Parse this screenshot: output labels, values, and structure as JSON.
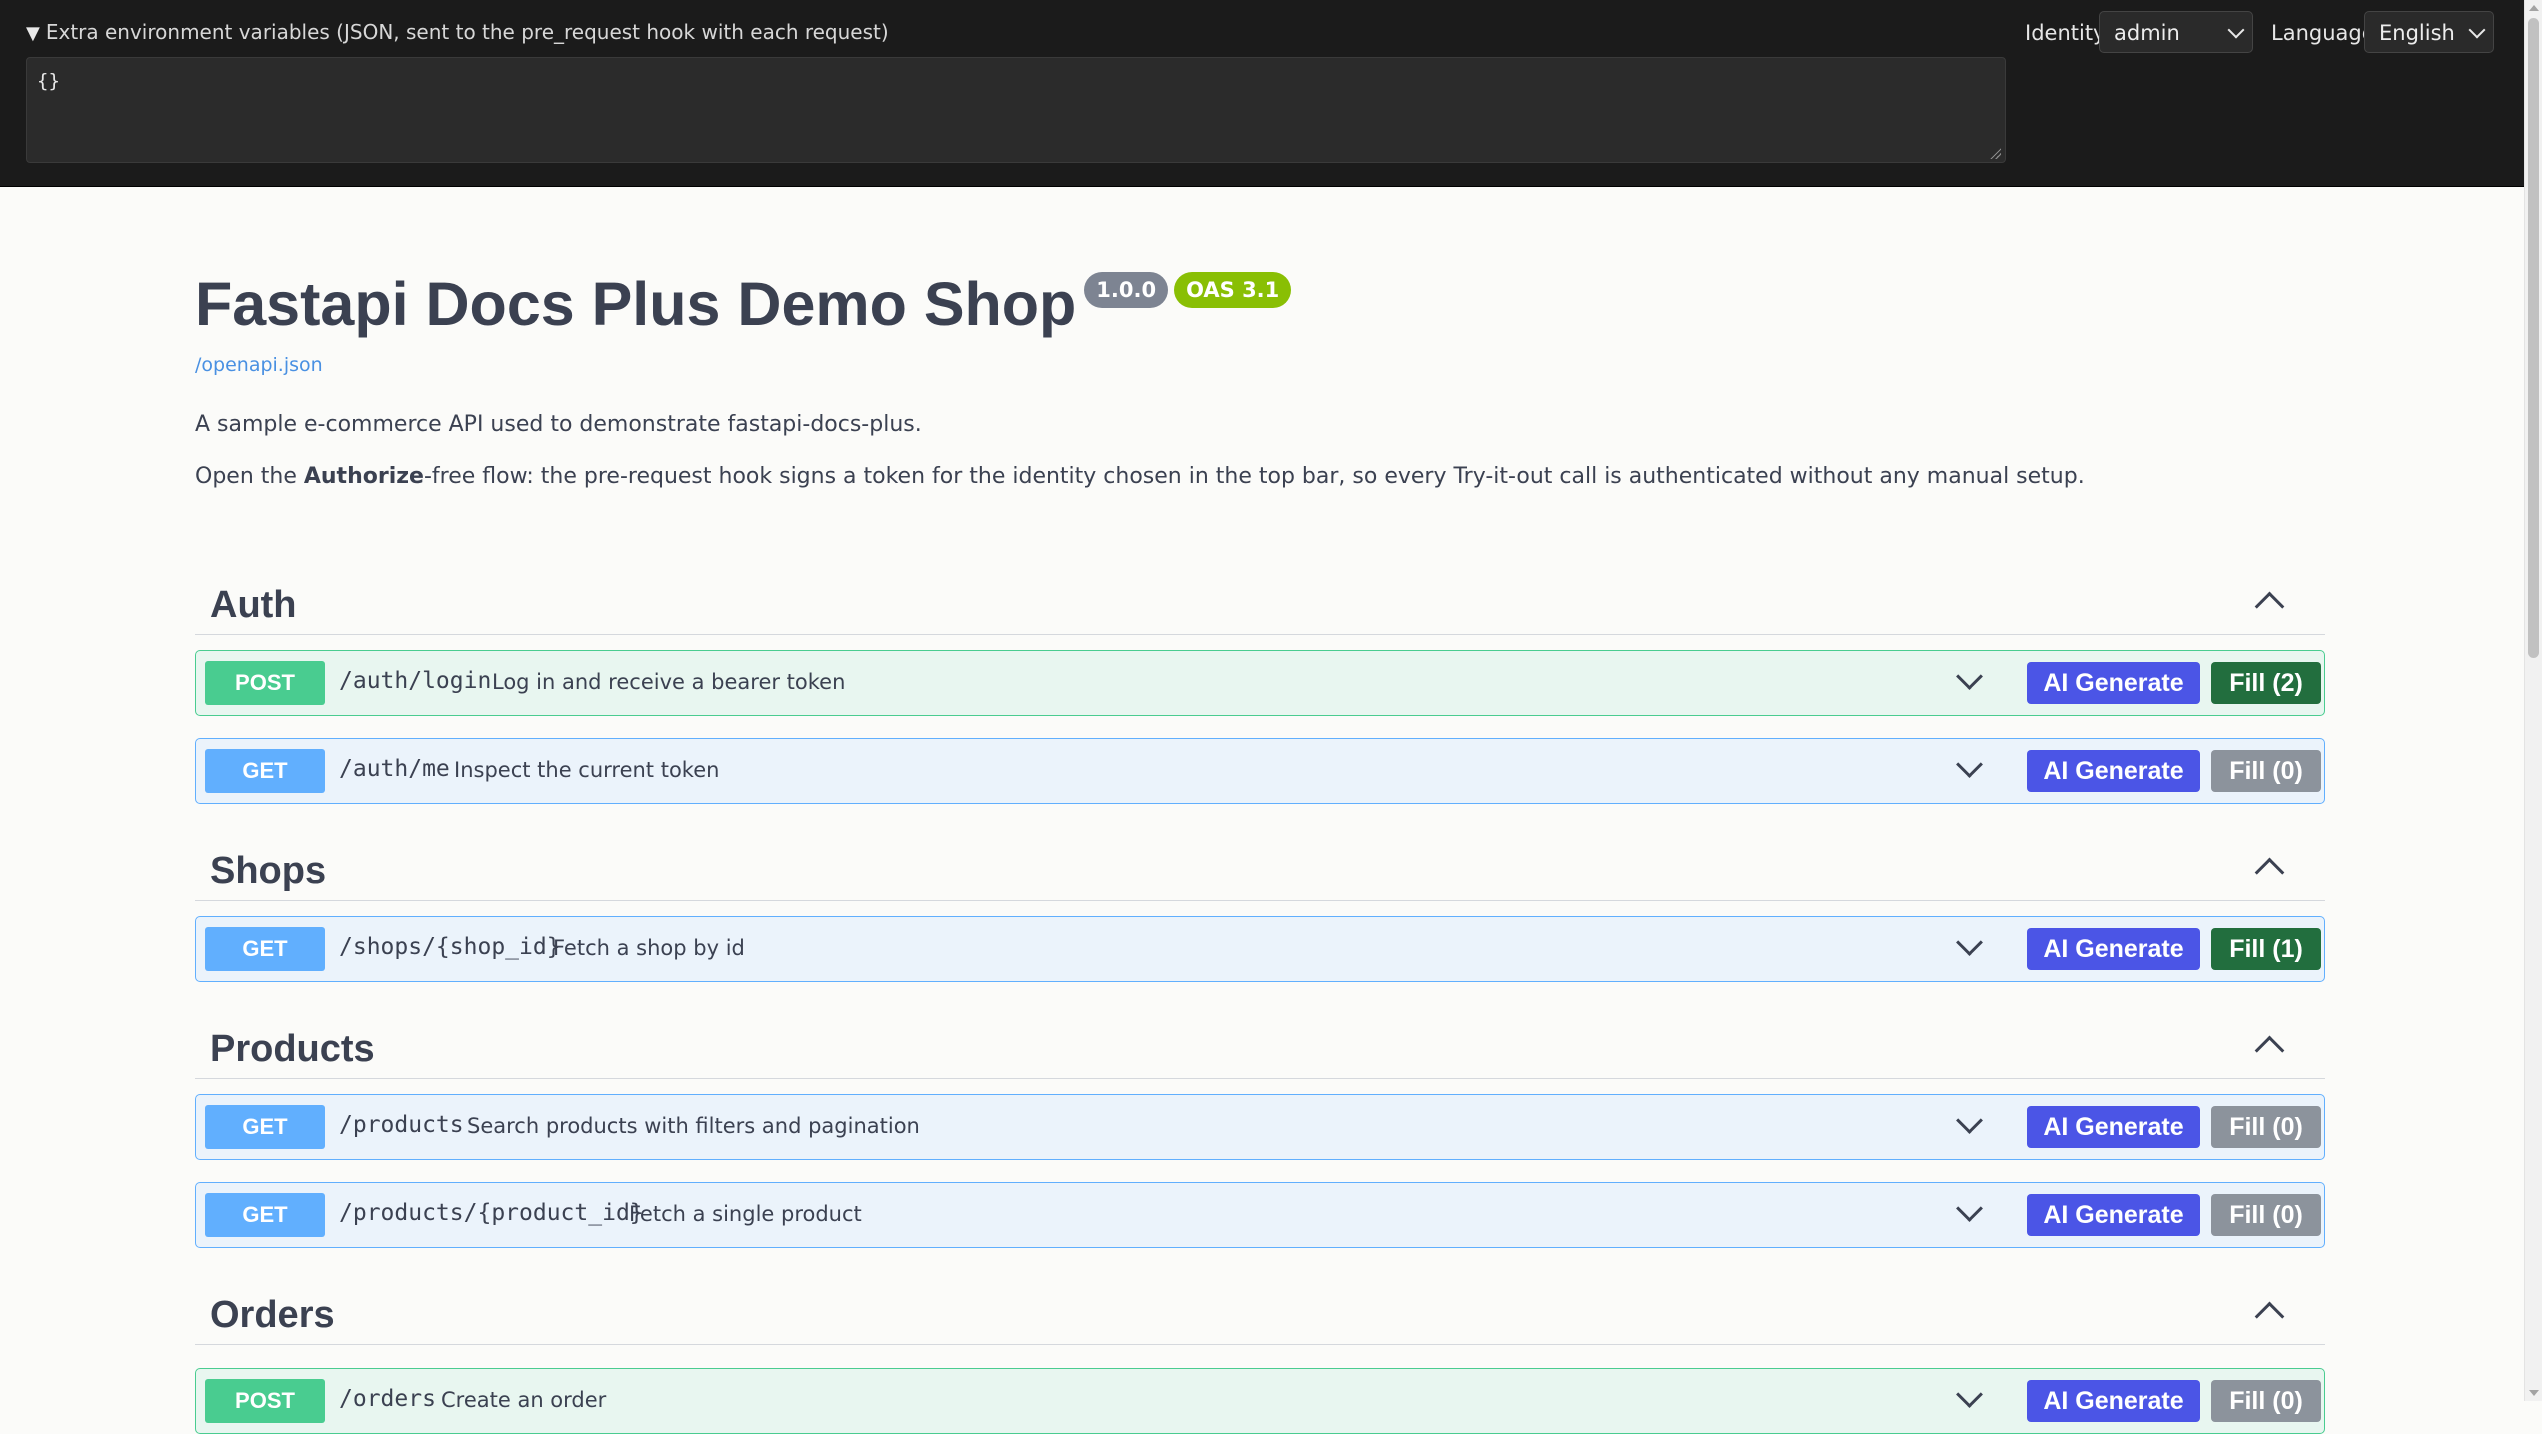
{
  "topbar": {
    "env_summary": "Extra environment variables (JSON, sent to the pre_request hook with each request)",
    "env_value": "{}",
    "identity_label": "Identity",
    "identity_value": "admin",
    "language_label": "Language",
    "language_value": "English"
  },
  "info": {
    "title": "Fastapi Docs Plus Demo Shop",
    "version": "1.0.0",
    "oas": "OAS 3.1",
    "spec_link": "/openapi.json",
    "description": "A sample e-commerce API used to demonstrate fastapi-docs-plus.",
    "description2_pre": "Open the ",
    "description2_bold": "Authorize",
    "description2_post": "-free flow: the pre-request hook signs a token for the identity chosen in the top bar, so every Try-it-out call is authenticated without any manual setup."
  },
  "tags": [
    {
      "name": "Auth",
      "operations": [
        {
          "method": "POST",
          "path": "/auth/login",
          "summary": "Log in and receive a bearer token",
          "ai_label": "AI Generate",
          "fill_label": "Fill (2)",
          "fill_active": true
        },
        {
          "method": "GET",
          "path": "/auth/me",
          "summary": "Inspect the current token",
          "ai_label": "AI Generate",
          "fill_label": "Fill (0)",
          "fill_active": false
        }
      ]
    },
    {
      "name": "Shops",
      "operations": [
        {
          "method": "GET",
          "path": "/shops/{shop_id}",
          "summary": "Fetch a shop by id",
          "ai_label": "AI Generate",
          "fill_label": "Fill (1)",
          "fill_active": true
        }
      ]
    },
    {
      "name": "Products",
      "operations": [
        {
          "method": "GET",
          "path": "/products",
          "summary": "Search products with filters and pagination",
          "ai_label": "AI Generate",
          "fill_label": "Fill (0)",
          "fill_active": false
        },
        {
          "method": "GET",
          "path": "/products/{product_id}",
          "summary": "Fetch a single product",
          "ai_label": "AI Generate",
          "fill_label": "Fill (0)",
          "fill_active": false
        }
      ]
    },
    {
      "name": "Orders",
      "operations": [
        {
          "method": "POST",
          "path": "/orders",
          "summary": "Create an order",
          "ai_label": "AI Generate",
          "fill_label": "Fill (0)",
          "fill_active": false
        }
      ]
    }
  ]
}
